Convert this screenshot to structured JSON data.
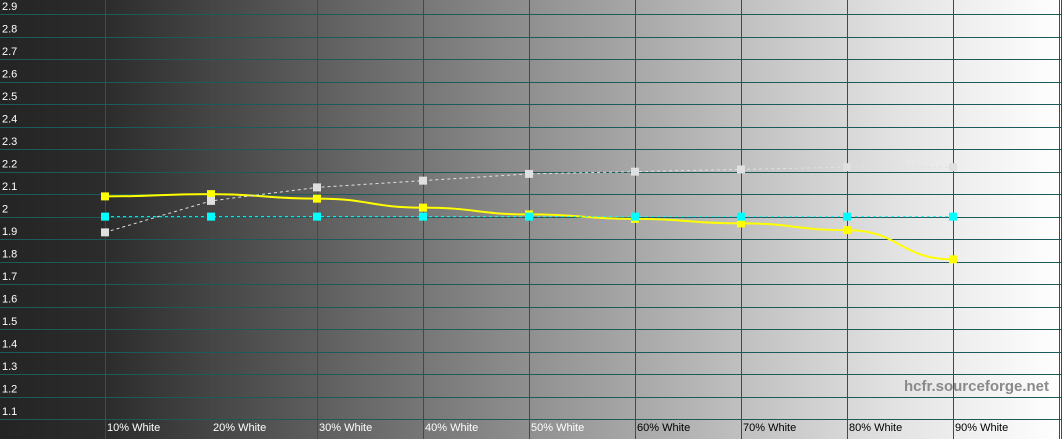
{
  "chart_data": {
    "type": "line",
    "categories": [
      "10% White",
      "20% White",
      "30% White",
      "40% White",
      "50% White",
      "60% White",
      "70% White",
      "80% White",
      "90% White"
    ],
    "y_ticks": [
      "1.1",
      "1.2",
      "1.3",
      "1.4",
      "1.5",
      "1.6",
      "1.7",
      "1.8",
      "1.9",
      "2",
      "2.1",
      "2.2",
      "2.3",
      "2.4",
      "2.5",
      "2.6",
      "2.7",
      "2.8",
      "2.9"
    ],
    "ylim": [
      1.02,
      2.95
    ],
    "grid": true,
    "background": "grayscale gradient from black (left) to white (right)",
    "series": [
      {
        "color": "#ffff00",
        "style": "solid",
        "values": [
          2.09,
          2.1,
          2.08,
          2.04,
          2.01,
          1.99,
          1.97,
          1.94,
          1.81
        ]
      },
      {
        "color": "#e0e0e0",
        "style": "dashed",
        "values": [
          1.93,
          2.07,
          2.13,
          2.16,
          2.19,
          2.2,
          2.21,
          2.22,
          2.22
        ]
      },
      {
        "color": "#00ffff",
        "style": "dashed",
        "values": [
          2.0,
          2.0,
          2.0,
          2.0,
          2.0,
          2.0,
          2.0,
          2.0,
          2.0
        ]
      }
    ],
    "watermark": "hcfr.sourceforge.net"
  }
}
